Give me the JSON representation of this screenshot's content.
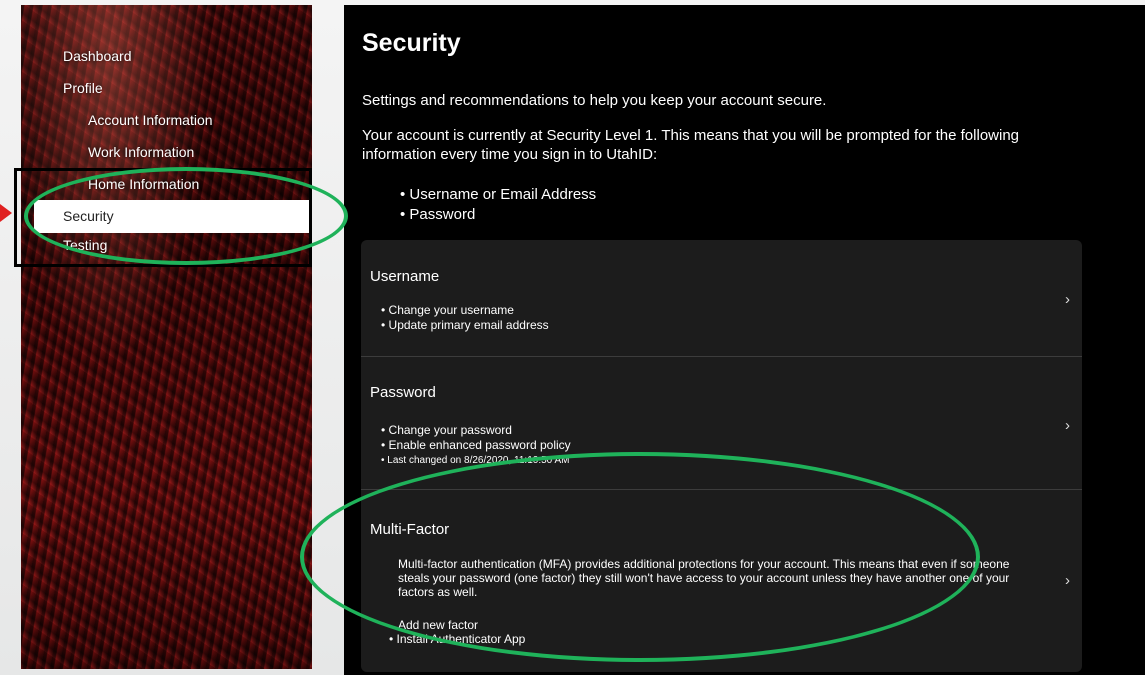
{
  "sidebar": {
    "items": [
      {
        "label": "Dashboard"
      },
      {
        "label": "Profile"
      },
      {
        "label": "Account Information"
      },
      {
        "label": "Work Information"
      },
      {
        "label": "Home Information"
      },
      {
        "label": "Security",
        "selected": true
      },
      {
        "label": "Testing"
      }
    ]
  },
  "main": {
    "title": "Security",
    "intro": "Settings and recommendations to help you keep your account secure.",
    "level_text": "Your account is currently at Security Level 1. This means that you will be prompted for the following information every time you sign in to UtahID:",
    "requirements": [
      "Username or Email Address",
      "Password"
    ],
    "cards": {
      "username": {
        "title": "Username",
        "items": [
          "Change your username",
          "Update primary email address"
        ],
        "chevron": "›"
      },
      "password": {
        "title": "Password",
        "items": [
          "Change your password",
          "Enable enhanced password policy",
          "Last changed on 8/26/2020, 11:10:50 AM"
        ],
        "chevron": "›"
      },
      "mfa": {
        "title": "Multi-Factor",
        "description": "Multi-factor authentication (MFA) provides additional protections for your account. This means that even if someone steals your password (one factor) they still won't have access to your account unless they have another one of your factors as well.",
        "add_factor": "Add new factor",
        "install_app": "Install Authenticator App",
        "chevron": "›"
      }
    }
  },
  "colors": {
    "annotation_green": "#1fb25a",
    "annotation_arrow": "#e02020",
    "main_bg": "#000000",
    "card_bg": "#1c1c1c"
  }
}
